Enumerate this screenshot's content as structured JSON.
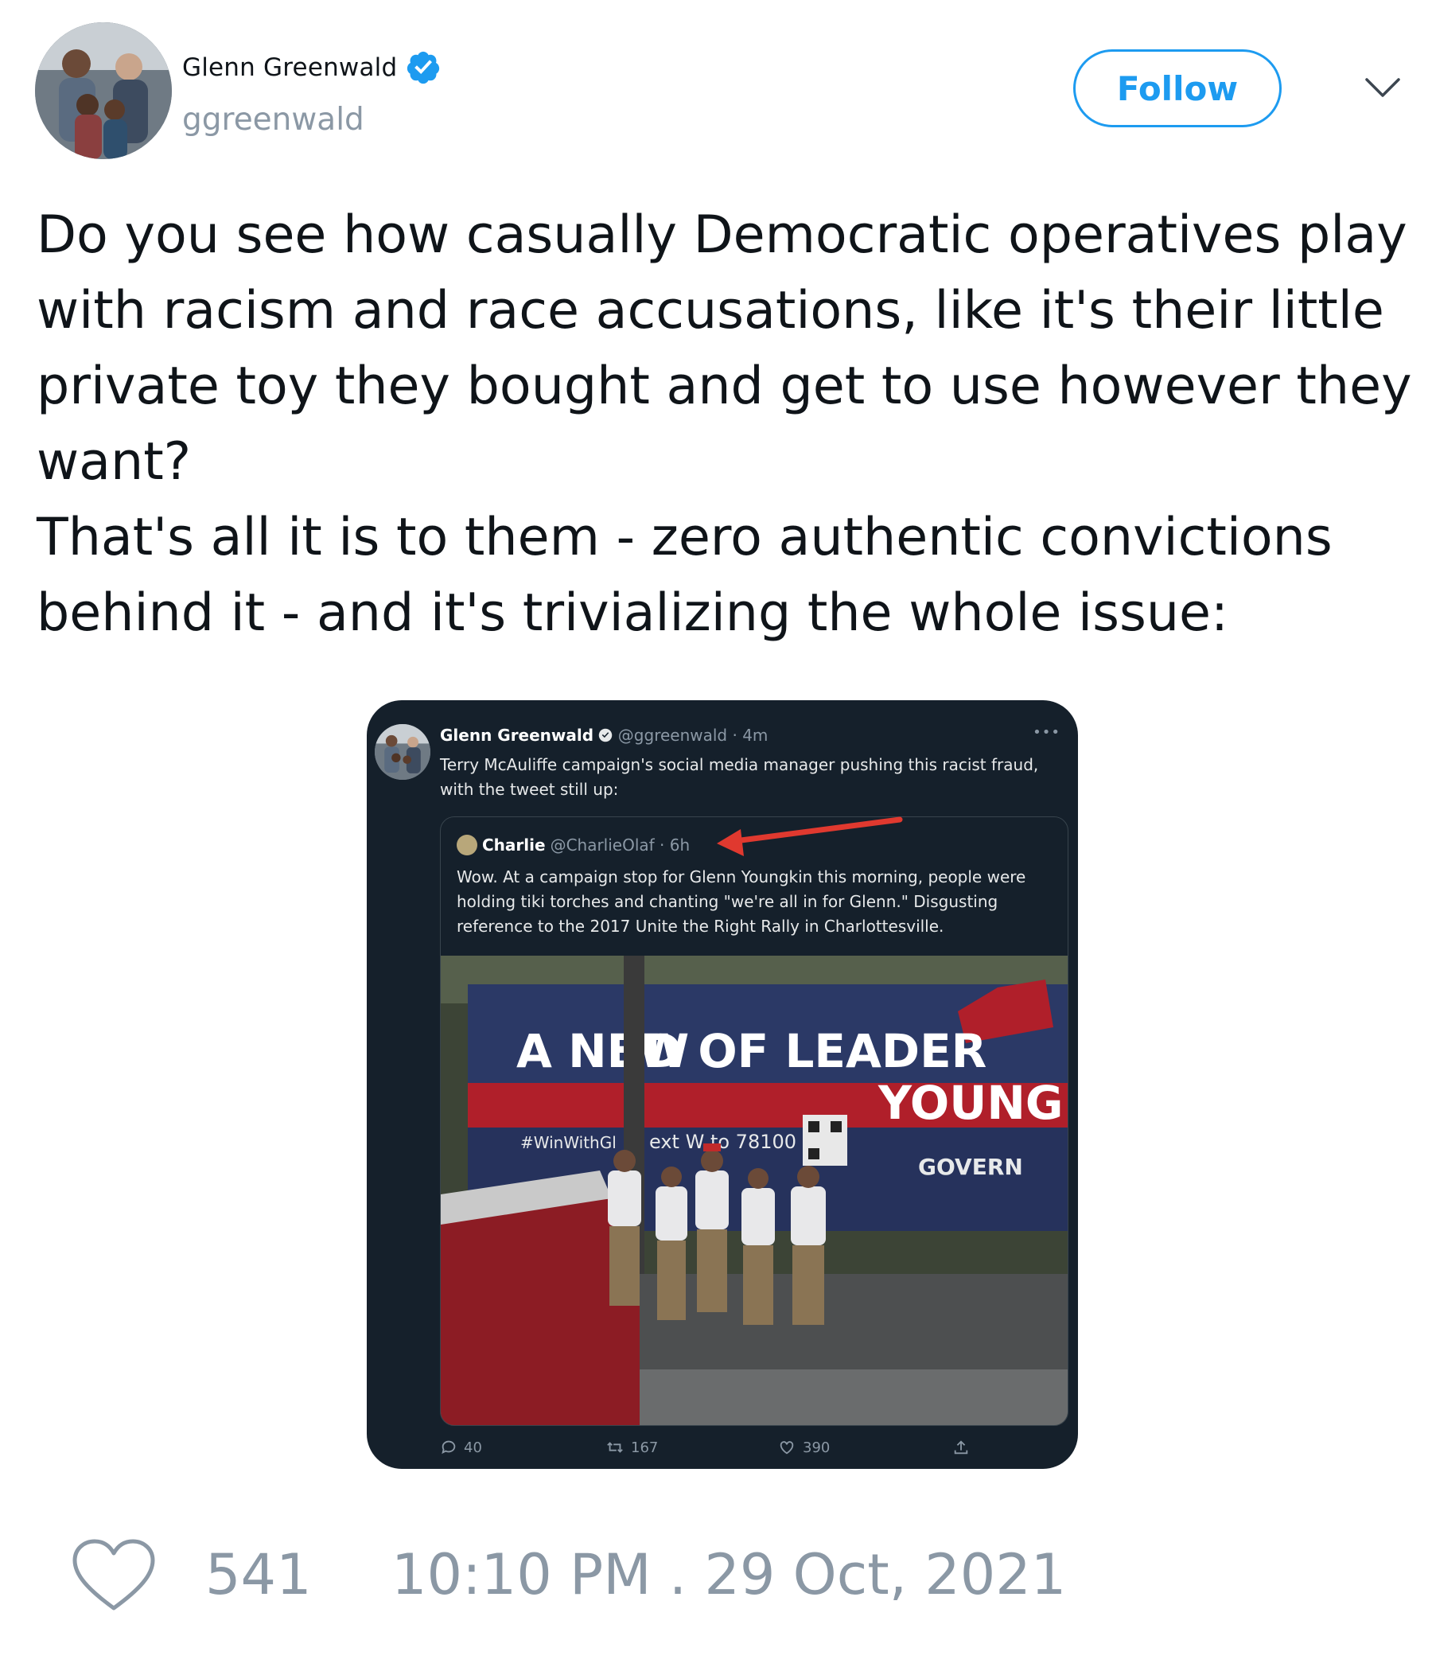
{
  "author": {
    "display_name": "Glenn Greenwald",
    "handle": "ggreenwald",
    "verified_icon": "verified-badge-icon"
  },
  "header": {
    "follow_label": "Follow",
    "more_icon": "chevron-down-icon"
  },
  "tweet": {
    "text": "Do you see how casually Democratic operatives play with racism and race accusations, like it's their little private toy they bought and get to use however they want?\nThat's all it is to them - zero authentic convictions behind it - and it's trivializing the whole issue:"
  },
  "embedded": {
    "author_name": "Glenn Greenwald",
    "author_meta": "@ggreenwald · 4m",
    "text": "Terry McAuliffe campaign's social media manager pushing this racist fraud, with the tweet still up:",
    "quoted": {
      "name": "Charlie",
      "meta": "@CharlieOlaf · 6h",
      "text": "Wow. At a campaign stop for Glenn Youngkin this morning, people were holding tiki torches and chanting \"we're all in for Glenn.\"  Disgusting reference to the 2017 Unite the Right Rally in Charlottesville.",
      "photo": {
        "bus_text_main": "A NEW",
        "bus_text_kind": "D OF LEADER",
        "bus_name": "YOUNG",
        "bus_sub": "GOVERN",
        "hashtag": "#WinWithGl",
        "text_line": "ext W  to 78100"
      }
    },
    "actions": {
      "replies": "40",
      "retweets": "167",
      "likes": "390"
    }
  },
  "footer": {
    "likes": "541",
    "timestamp": "10:10 PM . 29 Oct, 2021"
  },
  "colors": {
    "accent": "#1d9bf0",
    "muted": "#8b98a5",
    "dark_bg": "#15202b",
    "arrow": "#e0392f"
  }
}
